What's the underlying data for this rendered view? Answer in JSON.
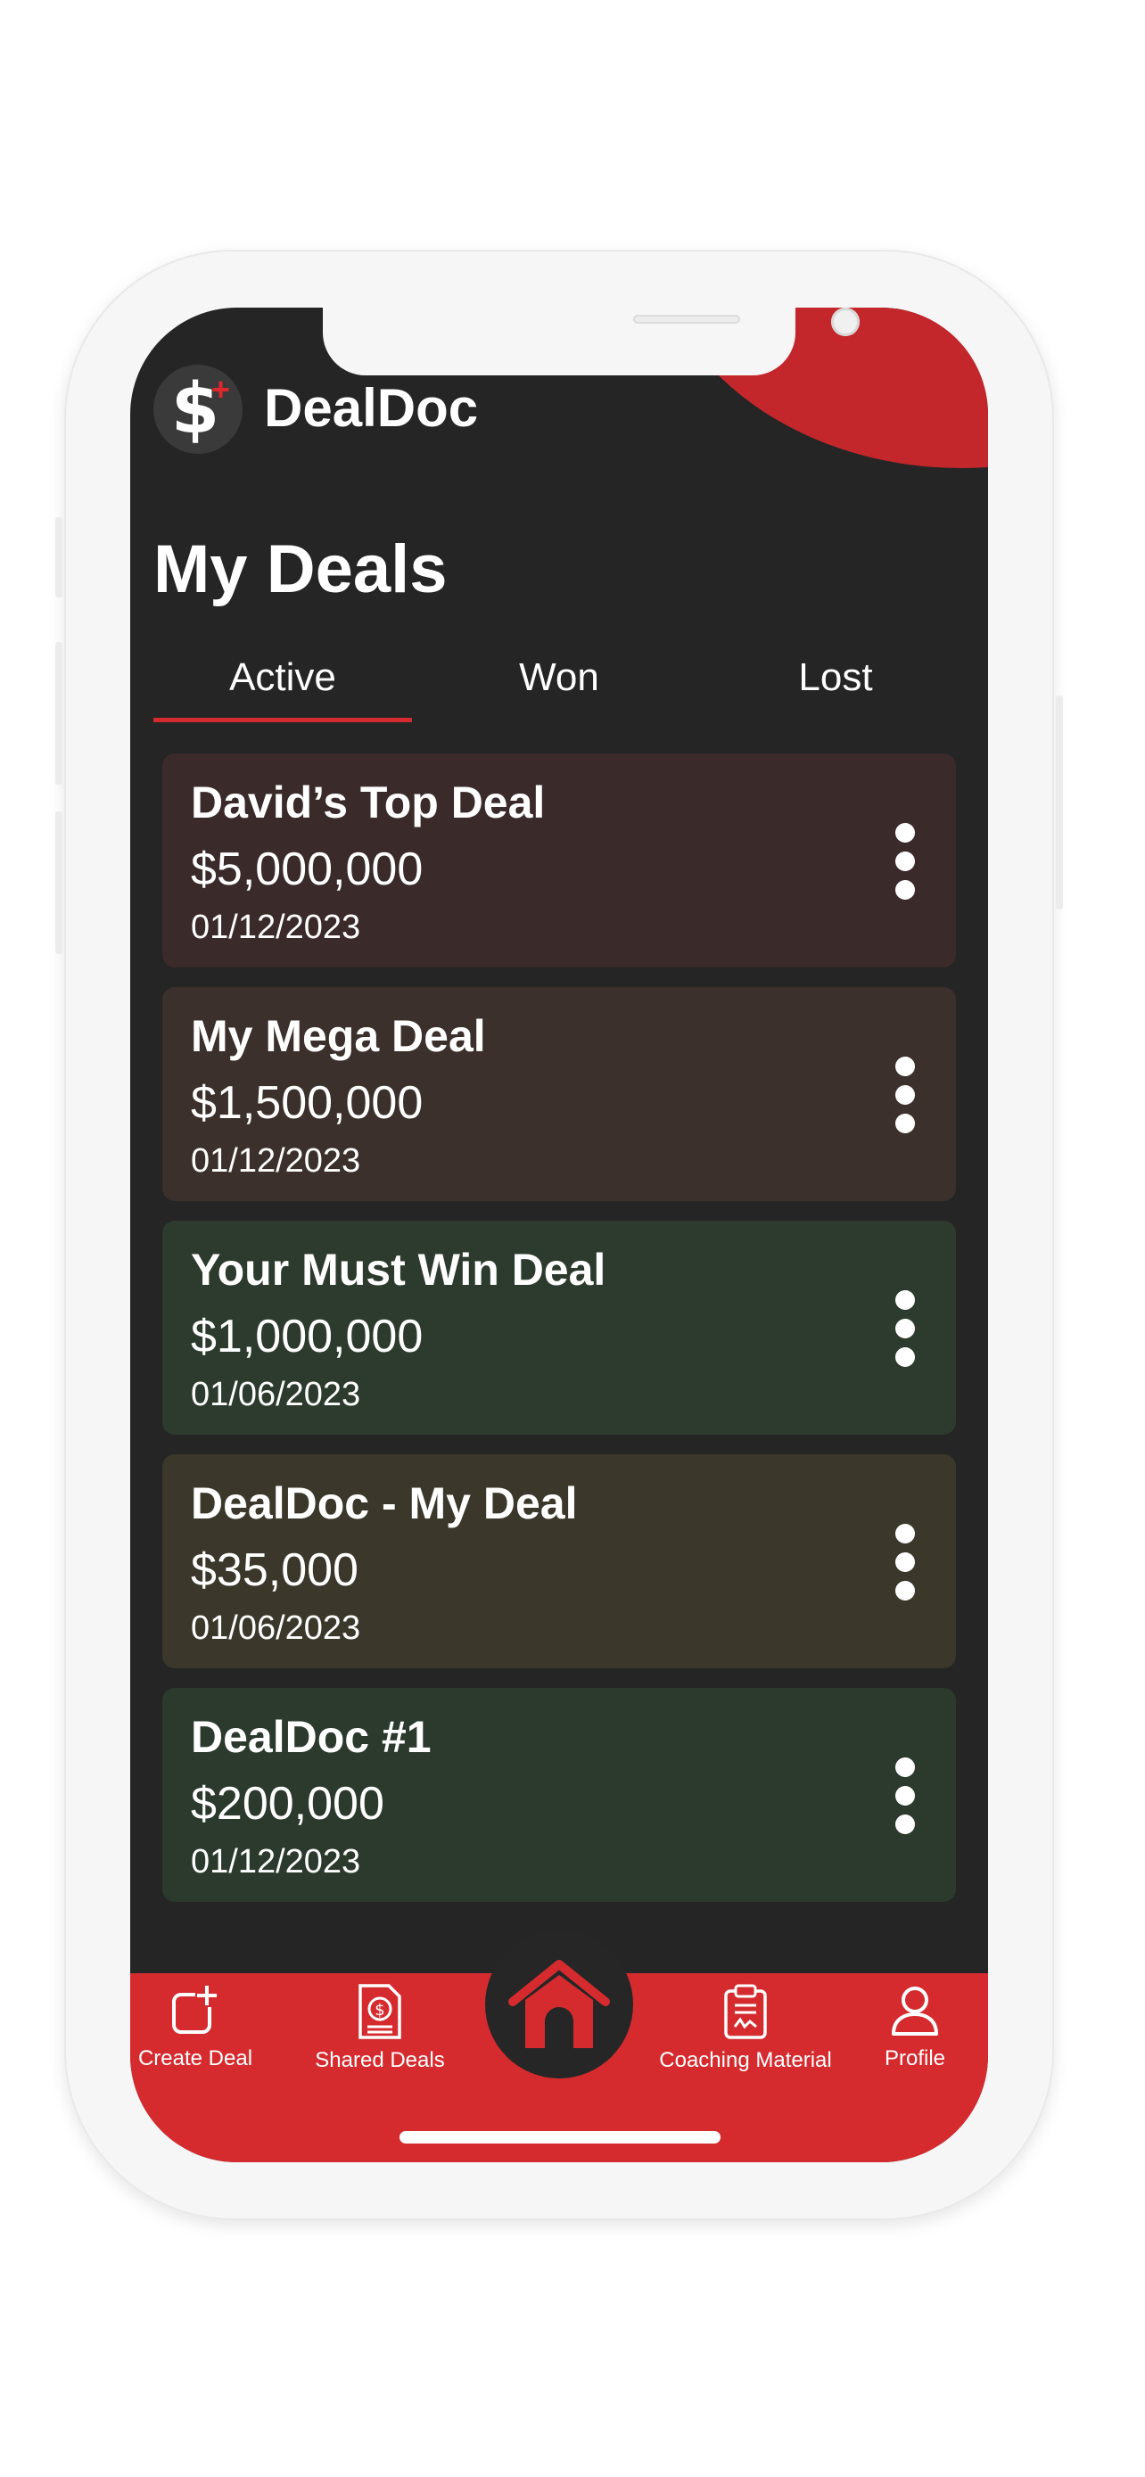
{
  "app": {
    "name": "DealDoc",
    "logo_glyph": "$",
    "logo_plus": "+"
  },
  "page": {
    "title": "My Deals"
  },
  "tabs": [
    {
      "label": "Active",
      "selected": true
    },
    {
      "label": "Won",
      "selected": false
    },
    {
      "label": "Lost",
      "selected": false
    }
  ],
  "deals": [
    {
      "name": "David’s Top Deal",
      "amount": "$5,000,000",
      "date": "01/12/2023",
      "color": "#3a2a2a"
    },
    {
      "name": "My Mega Deal",
      "amount": "$1,500,000",
      "date": "01/12/2023",
      "color": "#3b302b"
    },
    {
      "name": "Your Must Win Deal",
      "amount": "$1,000,000",
      "date": "01/06/2023",
      "color": "#2c3b2d"
    },
    {
      "name": "DealDoc - My Deal",
      "amount": "$35,000",
      "date": "01/06/2023",
      "color": "#3b382b"
    },
    {
      "name": "DealDoc #1",
      "amount": "$200,000",
      "date": "01/12/2023",
      "color": "#2b3a2c"
    }
  ],
  "nav": {
    "create_deal": "Create Deal",
    "shared_deals": "Shared Deals",
    "coaching_material": "Coaching Material",
    "profile": "Profile"
  },
  "colors": {
    "accent": "#d52b2f",
    "background": "#252525"
  }
}
